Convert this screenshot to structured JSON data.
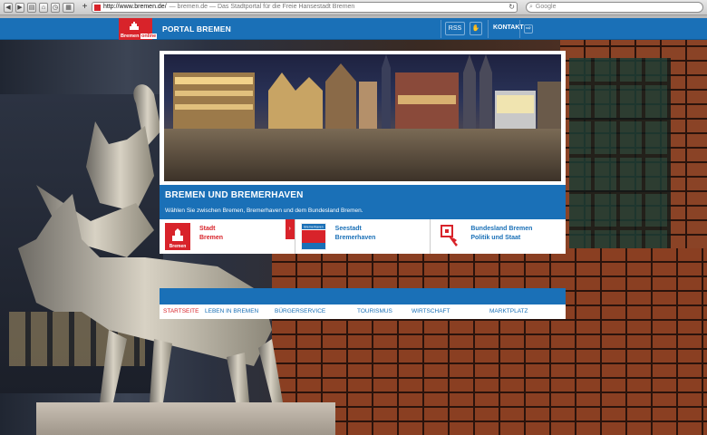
{
  "browser": {
    "url": "http://www.bremen.de/",
    "page_title": "— bremen.de — Das Stadtportal für die Freie Hansestadt Bremen",
    "search_placeholder": "Google",
    "new_tab_glyph": "+",
    "reload_glyph": "↻",
    "search_glyph": "⌕"
  },
  "header": {
    "logo_text": "Bremen",
    "logo_badge": "online",
    "portal_title": "PORTAL BREMEN",
    "accessibility_label": "RSS",
    "kontakt_label": "KONTAKT",
    "login_glyph": "⇨"
  },
  "hero": {
    "band_title": "BREMEN UND BREMERHAVEN",
    "band_subtitle": "Wählen Sie zwischen Bremen, Bremerhaven und dem Bundesland Bremen."
  },
  "choices": [
    {
      "line1": "Stadt",
      "line2": "Bremen",
      "icon": "bremen-logo-icon",
      "icon_label": "Bremen"
    },
    {
      "line1": "Seestadt",
      "line2": "Bremerhaven",
      "icon": "bremerhaven-flag-icon",
      "icon_label": "Bremerhaven"
    },
    {
      "line1": "Bundesland Bremen",
      "line2": "Politik und Staat",
      "icon": "key-icon"
    }
  ],
  "choice_arrow": "›",
  "nav": [
    {
      "label": "STARTSEITE",
      "active": true
    },
    {
      "label": "LEBEN IN BREMEN"
    },
    {
      "label": "BÜRGERSERVICE"
    },
    {
      "label": "TOURISMUS"
    },
    {
      "label": "WIRTSCHAFT"
    },
    {
      "label": "MARKTPLATZ"
    }
  ],
  "colors": {
    "brand_blue": "#1a70b7",
    "brand_red": "#d8232a"
  }
}
